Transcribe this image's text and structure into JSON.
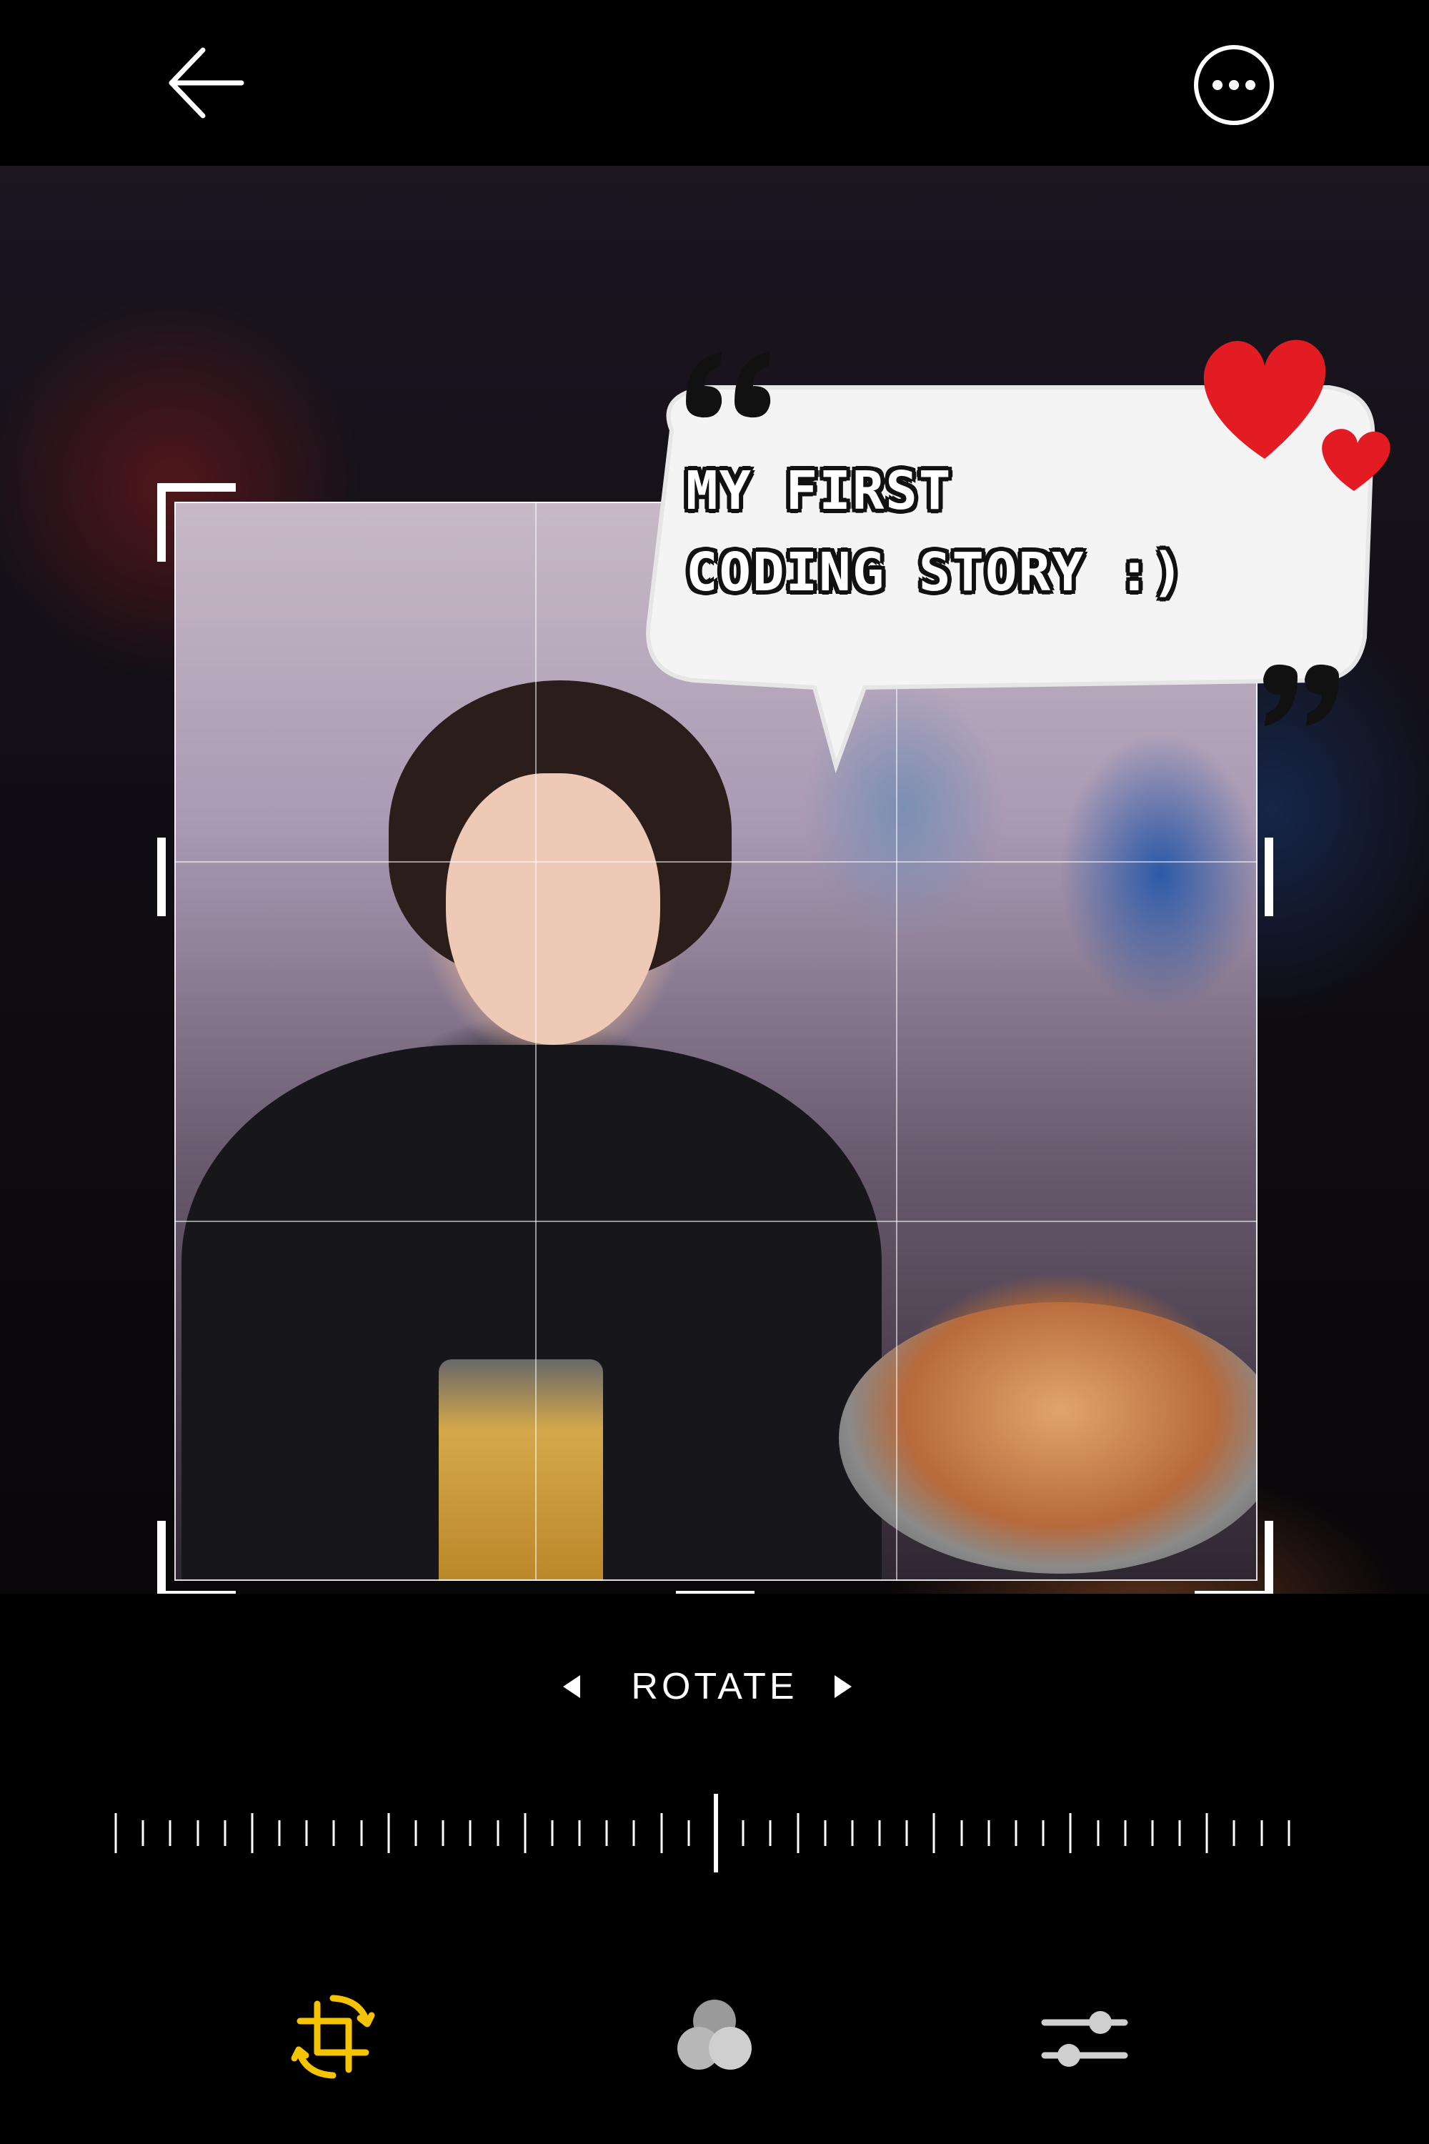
{
  "header": {
    "back_icon": "arrow-left-icon",
    "more_icon": "more-horizontal-icon"
  },
  "sticker": {
    "line1": "MY FIRST",
    "line2": "CODING STORY :)"
  },
  "rotate": {
    "label": "ROTATE",
    "left_icon": "triangle-left-icon",
    "right_icon": "triangle-right-icon",
    "angle": 0
  },
  "tools": [
    {
      "name": "crop",
      "icon": "crop-rotate-icon",
      "active": true
    },
    {
      "name": "filters",
      "icon": "filters-icon",
      "active": false
    },
    {
      "name": "adjust",
      "icon": "sliders-icon",
      "active": false
    }
  ],
  "colors": {
    "accent": "#F5C400",
    "inactive_icon": "#BDBDBD",
    "background": "#000000"
  }
}
